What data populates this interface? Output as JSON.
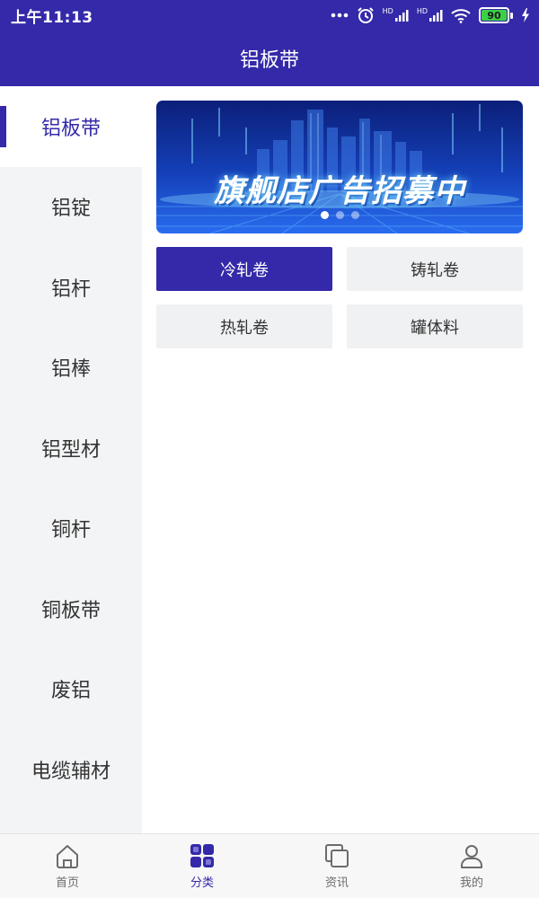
{
  "status_bar": {
    "time": "上午11:13",
    "signal_1_label": "HD",
    "signal_2_label": "HD",
    "battery": "90",
    "icons": [
      "more-dots-icon",
      "alarm-icon",
      "signal-icon",
      "signal-icon",
      "wifi-icon",
      "battery-icon",
      "charging-icon"
    ]
  },
  "header": {
    "title": "铝板带"
  },
  "sidebar": {
    "items": [
      {
        "label": "铝板带",
        "active": true
      },
      {
        "label": "铝锭",
        "active": false
      },
      {
        "label": "铝杆",
        "active": false
      },
      {
        "label": "铝棒",
        "active": false
      },
      {
        "label": "铝型材",
        "active": false
      },
      {
        "label": "铜杆",
        "active": false
      },
      {
        "label": "铜板带",
        "active": false
      },
      {
        "label": "废铝",
        "active": false
      },
      {
        "label": "电缆辅材",
        "active": false
      }
    ]
  },
  "banner": {
    "text": "旗舰店广告招募中",
    "dots": 3,
    "active_dot": 0
  },
  "subcategories": [
    {
      "label": "冷轧卷",
      "active": true
    },
    {
      "label": "铸轧卷",
      "active": false
    },
    {
      "label": "热轧卷",
      "active": false
    },
    {
      "label": "罐体料",
      "active": false
    }
  ],
  "tabbar": {
    "items": [
      {
        "label": "首页",
        "icon": "home-icon",
        "active": false
      },
      {
        "label": "分类",
        "icon": "category-grid-icon",
        "active": true
      },
      {
        "label": "资讯",
        "icon": "news-icon",
        "active": false
      },
      {
        "label": "我的",
        "icon": "user-icon",
        "active": false
      }
    ]
  },
  "colors": {
    "brand": "#3429a9",
    "sidebar_bg": "#f3f4f6",
    "chip_bg": "#f0f1f3",
    "battery_green": "#3bd048"
  }
}
